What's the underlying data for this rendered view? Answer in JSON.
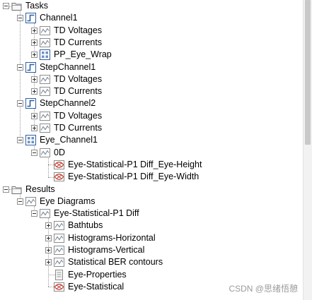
{
  "tree": [
    {
      "label": "Tasks",
      "icon": "folder-icon",
      "depth": 0,
      "expander": "minus"
    },
    {
      "label": "Channel1",
      "icon": "channel-icon",
      "depth": 1,
      "expander": "minus"
    },
    {
      "label": "TD Voltages",
      "icon": "waveform-icon",
      "depth": 2,
      "expander": "plus"
    },
    {
      "label": "TD Currents",
      "icon": "waveform-icon",
      "depth": 2,
      "expander": "plus"
    },
    {
      "label": "PP_Eye_Wrap",
      "icon": "grid-icon",
      "depth": 2,
      "expander": "plus"
    },
    {
      "label": "StepChannel1",
      "icon": "channel-icon",
      "depth": 1,
      "expander": "minus"
    },
    {
      "label": "TD Voltages",
      "icon": "waveform-icon",
      "depth": 2,
      "expander": "plus"
    },
    {
      "label": "TD Currents",
      "icon": "waveform-icon",
      "depth": 2,
      "expander": "plus"
    },
    {
      "label": "StepChannel2",
      "icon": "channel-icon",
      "depth": 1,
      "expander": "minus"
    },
    {
      "label": "TD Voltages",
      "icon": "waveform-icon",
      "depth": 2,
      "expander": "plus"
    },
    {
      "label": "TD Currents",
      "icon": "waveform-icon",
      "depth": 2,
      "expander": "plus"
    },
    {
      "label": "Eye_Channel1",
      "icon": "grid-icon",
      "depth": 1,
      "expander": "minus"
    },
    {
      "label": "0D",
      "icon": "waveform-icon",
      "depth": 2,
      "expander": "minus"
    },
    {
      "label": "Eye-Statistical-P1 Diff_Eye-Height",
      "icon": "eye-result-icon",
      "depth": 3,
      "expander": "none"
    },
    {
      "label": "Eye-Statistical-P1 Diff_Eye-Width",
      "icon": "eye-result-icon",
      "depth": 3,
      "expander": "none"
    },
    {
      "label": "Results",
      "icon": "folder-icon",
      "depth": 0,
      "expander": "minus"
    },
    {
      "label": "Eye Diagrams",
      "icon": "waveform-icon",
      "depth": 1,
      "expander": "minus"
    },
    {
      "label": "Eye-Statistical-P1 Diff",
      "icon": "waveform-icon",
      "depth": 2,
      "expander": "minus"
    },
    {
      "label": "Bathtubs",
      "icon": "waveform-icon",
      "depth": 3,
      "expander": "plus"
    },
    {
      "label": "Histograms-Horizontal",
      "icon": "waveform-icon",
      "depth": 3,
      "expander": "plus"
    },
    {
      "label": "Histograms-Vertical",
      "icon": "waveform-icon",
      "depth": 3,
      "expander": "plus"
    },
    {
      "label": "Statistical BER contours",
      "icon": "waveform-icon",
      "depth": 3,
      "expander": "plus"
    },
    {
      "label": "Eye-Properties",
      "icon": "properties-icon",
      "depth": 3,
      "expander": "none"
    },
    {
      "label": "Eye-Statistical",
      "icon": "eye-result-icon",
      "depth": 3,
      "expander": "none"
    }
  ],
  "watermark": "CSDN @思绪悟憩"
}
